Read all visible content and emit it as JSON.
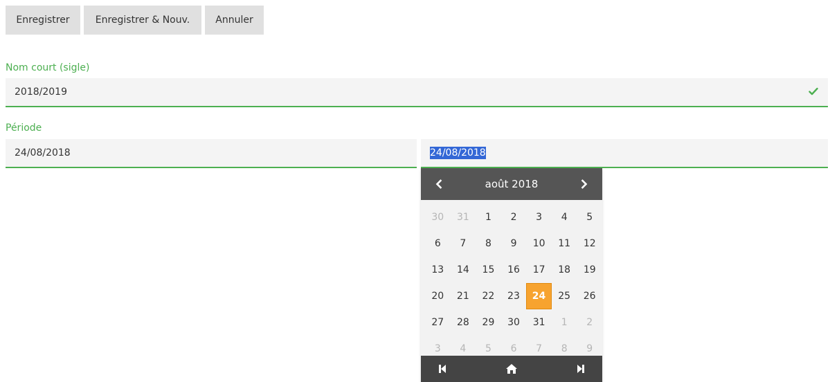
{
  "toolbar": {
    "save_label": "Enregistrer",
    "save_new_label": "Enregistrer & Nouv.",
    "cancel_label": "Annuler"
  },
  "form": {
    "short_name_label": "Nom court (sigle)",
    "short_name_value": "2018/2019",
    "period_label": "Période",
    "period_start_value": "24/08/2018",
    "period_end_value": "24/08/2018"
  },
  "calendar": {
    "month_title": "août 2018",
    "weeks": [
      [
        {
          "d": "30",
          "o": true
        },
        {
          "d": "31",
          "o": true
        },
        {
          "d": "1"
        },
        {
          "d": "2"
        },
        {
          "d": "3"
        },
        {
          "d": "4"
        },
        {
          "d": "5"
        }
      ],
      [
        {
          "d": "6"
        },
        {
          "d": "7"
        },
        {
          "d": "8"
        },
        {
          "d": "9"
        },
        {
          "d": "10"
        },
        {
          "d": "11"
        },
        {
          "d": "12"
        }
      ],
      [
        {
          "d": "13"
        },
        {
          "d": "14"
        },
        {
          "d": "15"
        },
        {
          "d": "16"
        },
        {
          "d": "17"
        },
        {
          "d": "18"
        },
        {
          "d": "19"
        }
      ],
      [
        {
          "d": "20"
        },
        {
          "d": "21"
        },
        {
          "d": "22"
        },
        {
          "d": "23"
        },
        {
          "d": "24",
          "s": true
        },
        {
          "d": "25"
        },
        {
          "d": "26"
        }
      ],
      [
        {
          "d": "27"
        },
        {
          "d": "28"
        },
        {
          "d": "29"
        },
        {
          "d": "30"
        },
        {
          "d": "31"
        },
        {
          "d": "1",
          "o": true
        },
        {
          "d": "2",
          "o": true
        }
      ],
      [
        {
          "d": "3",
          "o": true
        },
        {
          "d": "4",
          "o": true
        },
        {
          "d": "5",
          "o": true
        },
        {
          "d": "6",
          "o": true
        },
        {
          "d": "7",
          "o": true
        },
        {
          "d": "8",
          "o": true
        },
        {
          "d": "9",
          "o": true
        }
      ]
    ],
    "footer_icons": [
      "first-page-icon",
      "home-icon",
      "last-page-icon"
    ]
  },
  "icons": {
    "valid": "check-icon",
    "prev": "chevron-left-icon",
    "next": "chevron-right-icon"
  },
  "colors": {
    "accent_green": "#4caf50",
    "selected_day": "#f7a32f",
    "calendar_header": "#555555",
    "calendar_footer": "#444444",
    "text_selection": "#3367d6"
  }
}
